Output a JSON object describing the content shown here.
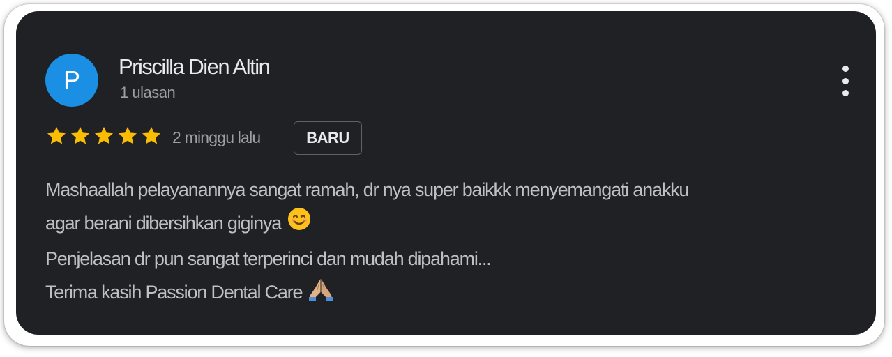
{
  "review": {
    "avatar_letter": "P",
    "reviewer_name": "Priscilla Dien Altin",
    "reviewer_meta": "1 ulasan",
    "rating": 5,
    "rating_max": 5,
    "time_ago": "2 minggu lalu",
    "badge": "BARU",
    "text_lines": [
      "Mashaallah pelayanannya sangat ramah, dr nya super baikkk menyemangati anakku",
      "agar berani dibersihkan giginya",
      "Penjelasan dr pun sangat terperinci dan mudah dipahami...",
      "Terima kasih Passion Dental Care"
    ]
  },
  "icons": {
    "menu": "more-vert-icon",
    "star": "star-icon",
    "smile": "smiling-face-emoji",
    "pray": "folded-hands-emoji"
  },
  "colors": {
    "card_background": "#202124",
    "avatar_background": "#1a8fe3",
    "star": "#fbbc04",
    "primary_text": "#e8eaed",
    "secondary_text": "#9aa0a6"
  }
}
